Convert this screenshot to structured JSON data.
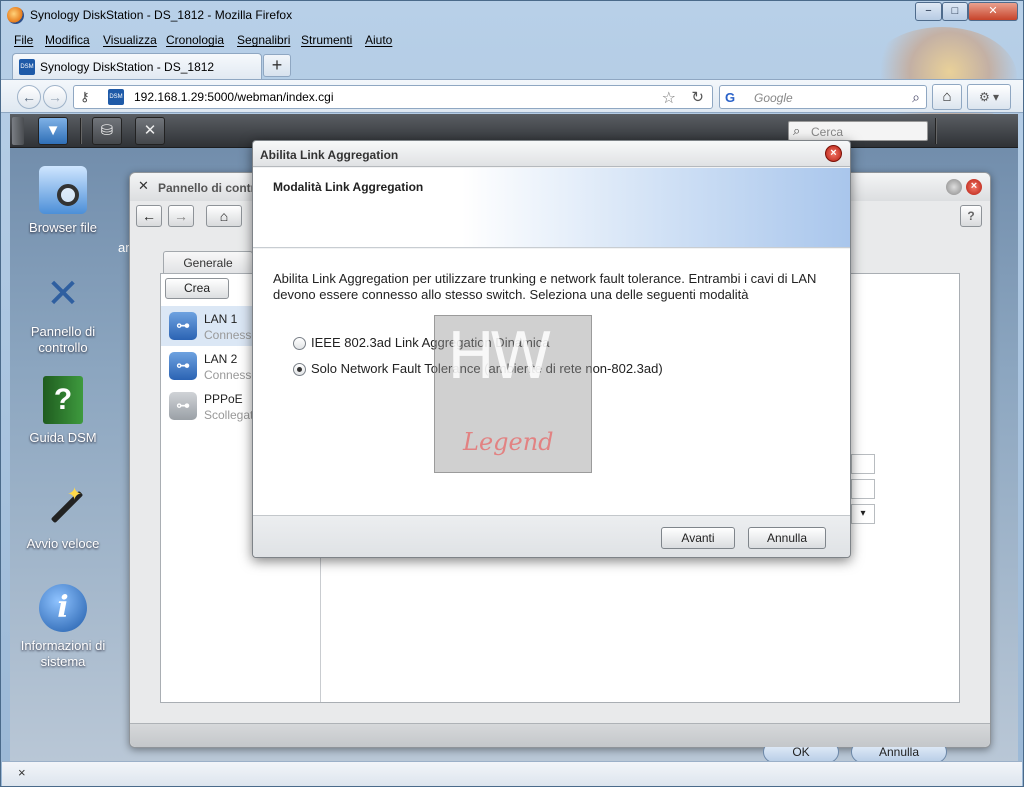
{
  "firefox": {
    "window_title": "Synology DiskStation - DS_1812 - Mozilla Firefox",
    "window_controls": {
      "minimize": "−",
      "maximize": "□",
      "close": "✕"
    },
    "menu": [
      "File",
      "Modifica",
      "Visualizza",
      "Cronologia",
      "Segnalibri",
      "Strumenti",
      "Aiuto"
    ],
    "tab_title": "Synology DiskStation - DS_1812",
    "tab_favicon": "DSM",
    "new_tab": "+",
    "url": "192.168.1.29:5000/webman/index.cgi",
    "search_placeholder": "Google",
    "status_close": "×"
  },
  "dsm": {
    "taskbar_search_placeholder": "Cerca",
    "desktop_icons": [
      {
        "label": "Browser file",
        "icon": "folder-search-icon"
      },
      {
        "label": "Pannello di controllo",
        "icon": "tools-icon"
      },
      {
        "label": "Guida DSM",
        "icon": "help-book-icon"
      },
      {
        "label": "Avvio veloce",
        "icon": "magic-wand-icon"
      },
      {
        "label": "Informazioni di sistema",
        "icon": "info-icon"
      }
    ],
    "partial_desktop_label": "ar"
  },
  "control_panel": {
    "title": "Pannello di controllo - Rete",
    "tabs": [
      "Generale"
    ],
    "crea_label": "Crea",
    "interfaces": [
      {
        "name": "LAN 1",
        "status": "Connesso"
      },
      {
        "name": "LAN 2",
        "status": "Connesso"
      },
      {
        "name": "PPPoE",
        "status": "Scollegato"
      }
    ],
    "ok_label": "OK",
    "cancel_label": "Annulla",
    "help": "?"
  },
  "dialog": {
    "title": "Abilita Link Aggregation",
    "header": "Modalità Link Aggregation",
    "description": "Abilita Link Aggregation per utilizzare trunking e network fault tolerance. Entrambi i cavi di LAN devono essere connesso allo stesso switch. Seleziona una delle seguenti modalità",
    "options": [
      {
        "label": "IEEE 802.3ad Link Aggregation Dinamica",
        "selected": false
      },
      {
        "label": "Solo Network Fault Tolerance (ambiente di rete non-802.3ad)",
        "selected": true
      }
    ],
    "next_label": "Avanti",
    "cancel_label": "Annulla"
  },
  "watermark": {
    "top": "HW",
    "bottom": "Legend"
  },
  "colors": {
    "accent": "#2f6fb7",
    "close_red": "#b51c10"
  }
}
